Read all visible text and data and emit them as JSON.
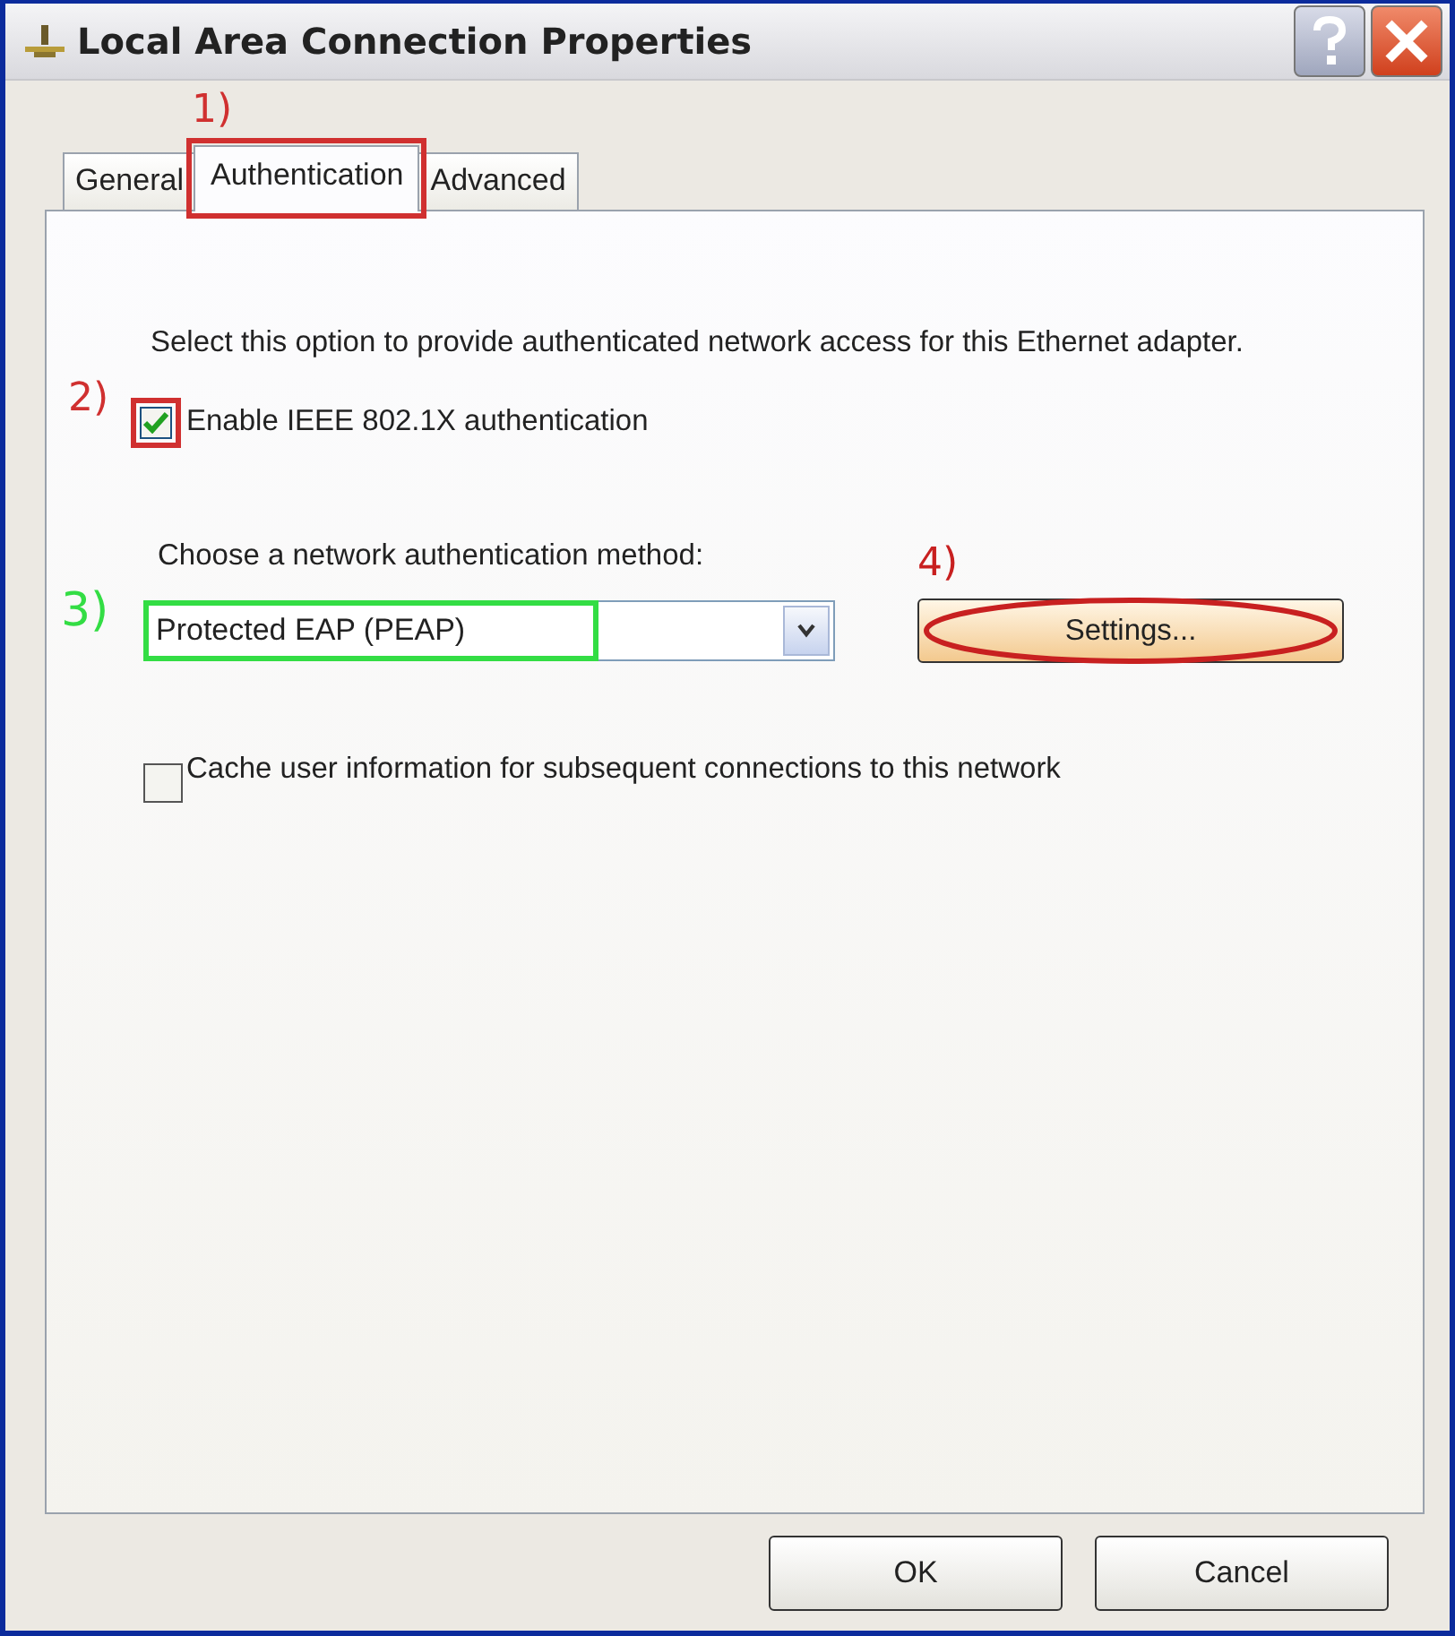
{
  "window": {
    "title": "Local Area Connection Properties"
  },
  "tabs": [
    {
      "label": "General",
      "selected": false
    },
    {
      "label": "Authentication",
      "selected": true,
      "annotation": {
        "label": "1)",
        "color": "#d03030"
      }
    },
    {
      "label": "Advanced",
      "selected": false
    }
  ],
  "description": "Select this option to provide authenticated network access for this Ethernet adapter.",
  "enable_checkbox": {
    "label": "Enable IEEE 802.1X authentication",
    "checked": true,
    "annotation": {
      "label": "2)",
      "color": "#d03030"
    }
  },
  "method_label": "Choose a network authentication method:",
  "method_dropdown": {
    "value": "Protected EAP (PEAP)",
    "annotation": {
      "label": "3)",
      "color": "#33dd44"
    }
  },
  "settings_button": {
    "label": "Settings...",
    "annotation": {
      "label": "4)",
      "color": "#c82020"
    }
  },
  "cache_checkbox": {
    "label": "Cache user information for subsequent connections to this network",
    "checked": false
  },
  "buttons": [
    "OK",
    "Cancel"
  ]
}
